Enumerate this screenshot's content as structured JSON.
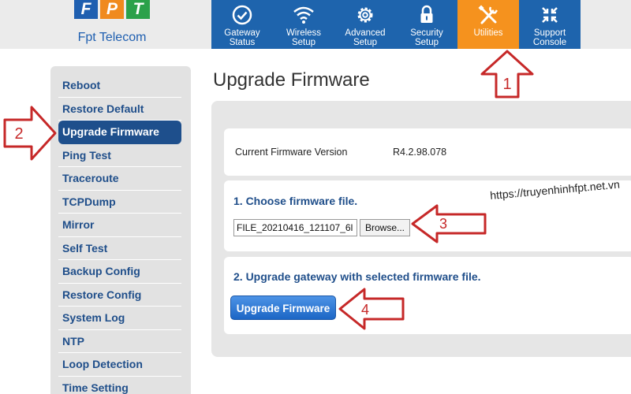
{
  "brand": {
    "logo_letters": [
      "F",
      "P",
      "T"
    ],
    "logo_text": "Fpt Telecom"
  },
  "nav": [
    {
      "icon": "check-circle-icon",
      "label1": "Gateway",
      "label2": "Status"
    },
    {
      "icon": "wifi-icon",
      "label1": "Wireless",
      "label2": "Setup"
    },
    {
      "icon": "gear-icon",
      "label1": "Advanced",
      "label2": "Setup"
    },
    {
      "icon": "lock-icon",
      "label1": "Security",
      "label2": "Setup"
    },
    {
      "icon": "tools-icon",
      "label1": "Utilities",
      "label2": ""
    },
    {
      "icon": "arrows-inward-icon",
      "label1": "Support",
      "label2": "Console"
    }
  ],
  "sidebar": {
    "items": [
      {
        "label": "Reboot"
      },
      {
        "label": "Restore Default"
      },
      {
        "label": "Upgrade Firmware"
      },
      {
        "label": "Ping Test"
      },
      {
        "label": "Traceroute"
      },
      {
        "label": "TCPDump"
      },
      {
        "label": "Mirror"
      },
      {
        "label": "Self Test"
      },
      {
        "label": "Backup Config"
      },
      {
        "label": "Restore Config"
      },
      {
        "label": "System Log"
      },
      {
        "label": "NTP"
      },
      {
        "label": "Loop Detection"
      },
      {
        "label": "Time Setting"
      }
    ],
    "active_index": 2
  },
  "main": {
    "title": "Upgrade Firmware",
    "current_firmware_label": "Current Firmware Version",
    "current_firmware_value": "R4.2.98.078",
    "choose_heading": "1. Choose firmware file.",
    "file_value": "FILE_20210416_121107_6l",
    "browse_label": "Browse...",
    "upgrade_heading": "2. Upgrade gateway with selected firmware file.",
    "upgrade_button_label": "Upgrade Firmware"
  },
  "watermark": "https://truyenhinhfpt.net.vn",
  "callouts": [
    "1",
    "2",
    "3",
    "4"
  ],
  "colors": {
    "nav_blue": "#1e64ad",
    "nav_active_orange": "#f5921e",
    "sidebar_text": "#1f4e8a",
    "callout_red": "#c62828"
  }
}
